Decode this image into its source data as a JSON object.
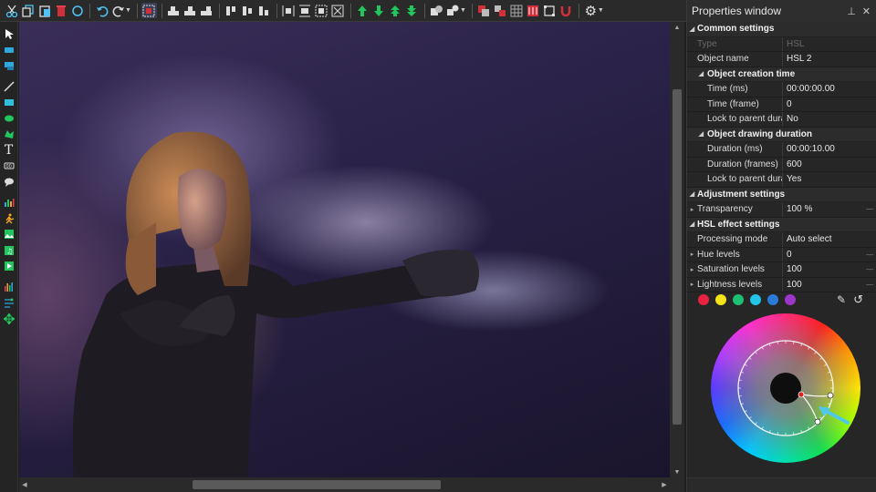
{
  "toolbar": {
    "icons": [
      "cut-icon",
      "copy-icon",
      "paste-icon",
      "delete-icon",
      "circle-icon",
      "undo-icon",
      "redo-icon",
      "select-all-icon",
      "align-left-icon",
      "align-center-icon",
      "align-right-icon",
      "align-top-icon",
      "align-middle-icon",
      "align-bottom-icon",
      "distribute-h-icon",
      "distribute-v-icon",
      "fit-size-icon",
      "fit-canvas-icon",
      "bring-forward-icon",
      "send-backward-icon",
      "bring-front-icon",
      "send-back-icon",
      "group-icon",
      "ungroup-icon",
      "snap-icon",
      "grid-icon",
      "mask-icon",
      "crop-icon",
      "magnet-icon",
      "settings-icon"
    ]
  },
  "left_tools": [
    "pointer-icon",
    "rect-icon",
    "textbox-icon",
    "line-icon",
    "rectangle-icon",
    "ellipse-icon",
    "shape-icon",
    "text-icon",
    "counter-icon",
    "callout-icon",
    "chart-icon",
    "person-icon",
    "image-icon",
    "audio-icon",
    "video-icon",
    "equalizer-icon",
    "motion-icon",
    "move-icon"
  ],
  "panel": {
    "title": "Properties window",
    "pin_icon": "pin-icon",
    "close_icon": "close-icon",
    "sections": {
      "common": "Common settings",
      "creation": "Object creation time",
      "drawing": "Object drawing duration",
      "adjustment": "Adjustment settings",
      "hsl": "HSL effect settings"
    },
    "rows": {
      "type_key": "Type",
      "type_val": "HSL",
      "name_key": "Object name",
      "name_val": "HSL 2",
      "time_ms_key": "Time (ms)",
      "time_ms_val": "00:00:00.00",
      "time_frame_key": "Time (frame)",
      "time_frame_val": "0",
      "lock1_key": "Lock to parent duration",
      "lock1_val": "No",
      "dur_ms_key": "Duration (ms)",
      "dur_ms_val": "00:00:10.00",
      "dur_frames_key": "Duration (frames)",
      "dur_frames_val": "600",
      "lock2_key": "Lock to parent duration",
      "lock2_val": "Yes",
      "transparency_key": "Transparency",
      "transparency_val": "100 %",
      "processing_key": "Processing mode",
      "processing_val": "Auto select",
      "hue_key": "Hue levels",
      "hue_val": "0",
      "sat_key": "Saturation levels",
      "sat_val": "100",
      "light_key": "Lightness levels",
      "light_val": "100"
    },
    "swatch_colors": [
      "#e8223f",
      "#f5e31a",
      "#1dbf73",
      "#22c4e8",
      "#2a7ad8",
      "#9b36c9"
    ],
    "colors": {
      "accent_arrow": "#4ec9e8",
      "panel_bg": "#262626"
    }
  }
}
